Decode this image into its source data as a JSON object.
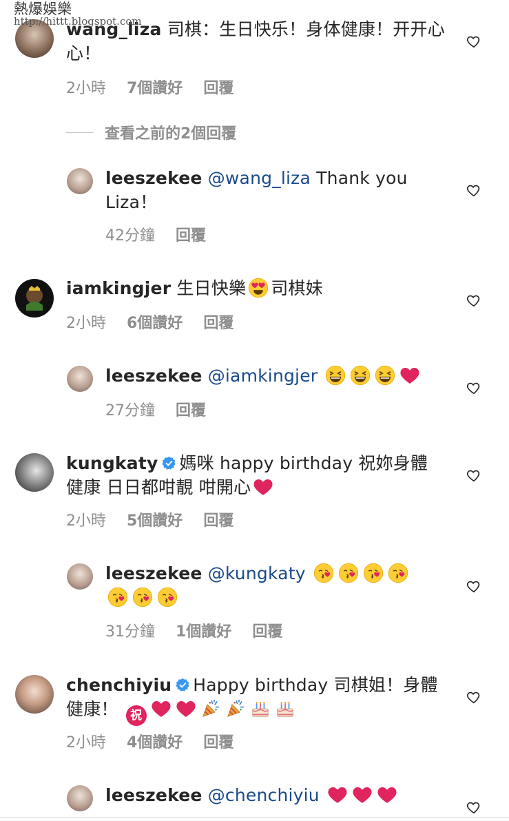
{
  "watermark": {
    "title": "熱爆娛樂",
    "url": "http://hittt.blogspot.com"
  },
  "heart_icon": "heart-outline-icon",
  "colors": {
    "text": "#262626",
    "meta": "#8e8e8e",
    "mention": "#1a4a8c",
    "verified": "#3897f0",
    "heart_emoji": "#e0245e"
  },
  "view_previous": "查看之前的2個回覆",
  "comments": [
    {
      "user": "wang_liza",
      "text": "司棋：生日快乐！身体健康！开开心心！",
      "time": "2小時",
      "likes": "7個讚好",
      "reply": "回覆"
    },
    {
      "user": "leeszekee",
      "mention": "@wang_liza",
      "text": "Thank you Liza！",
      "time": "42分鐘",
      "reply": "回覆"
    },
    {
      "user": "iamkingjer",
      "text_before": "生日快樂",
      "emoji": "heart-eyes",
      "text_after": "司棋妹",
      "time": "2小時",
      "likes": "6個讚好",
      "reply": "回覆"
    },
    {
      "user": "leeszekee",
      "mention": "@iamkingjer",
      "emojis": [
        "laughing",
        "laughing",
        "laughing",
        "red-heart"
      ],
      "time": "27分鐘",
      "reply": "回覆"
    },
    {
      "user": "kungkaty",
      "verified": true,
      "text": "媽咪 happy birthday 祝妳身體健康 日日都咁靚 咁開心",
      "emojis": [
        "red-heart"
      ],
      "time": "2小時",
      "likes": "5個讚好",
      "reply": "回覆"
    },
    {
      "user": "leeszekee",
      "mention": "@kungkaty",
      "emojis": [
        "kiss",
        "kiss",
        "kiss",
        "kiss",
        "kiss",
        "kiss",
        "kiss"
      ],
      "time": "31分鐘",
      "likes": "1個讚好",
      "reply": "回覆"
    },
    {
      "user": "chenchiyiu",
      "verified": true,
      "text": "Happy birthday 司棋姐！身體健康！",
      "emojis": [
        "祝",
        "red-heart",
        "red-heart",
        "party-popper",
        "party-popper",
        "cake",
        "cake"
      ],
      "time": "2小時",
      "likes": "4個讚好",
      "reply": "回覆"
    },
    {
      "user": "leeszekee",
      "mention": "@chenchiyiu",
      "emojis": [
        "red-heart",
        "red-heart",
        "red-heart"
      ],
      "time": "",
      "reply": ""
    }
  ]
}
